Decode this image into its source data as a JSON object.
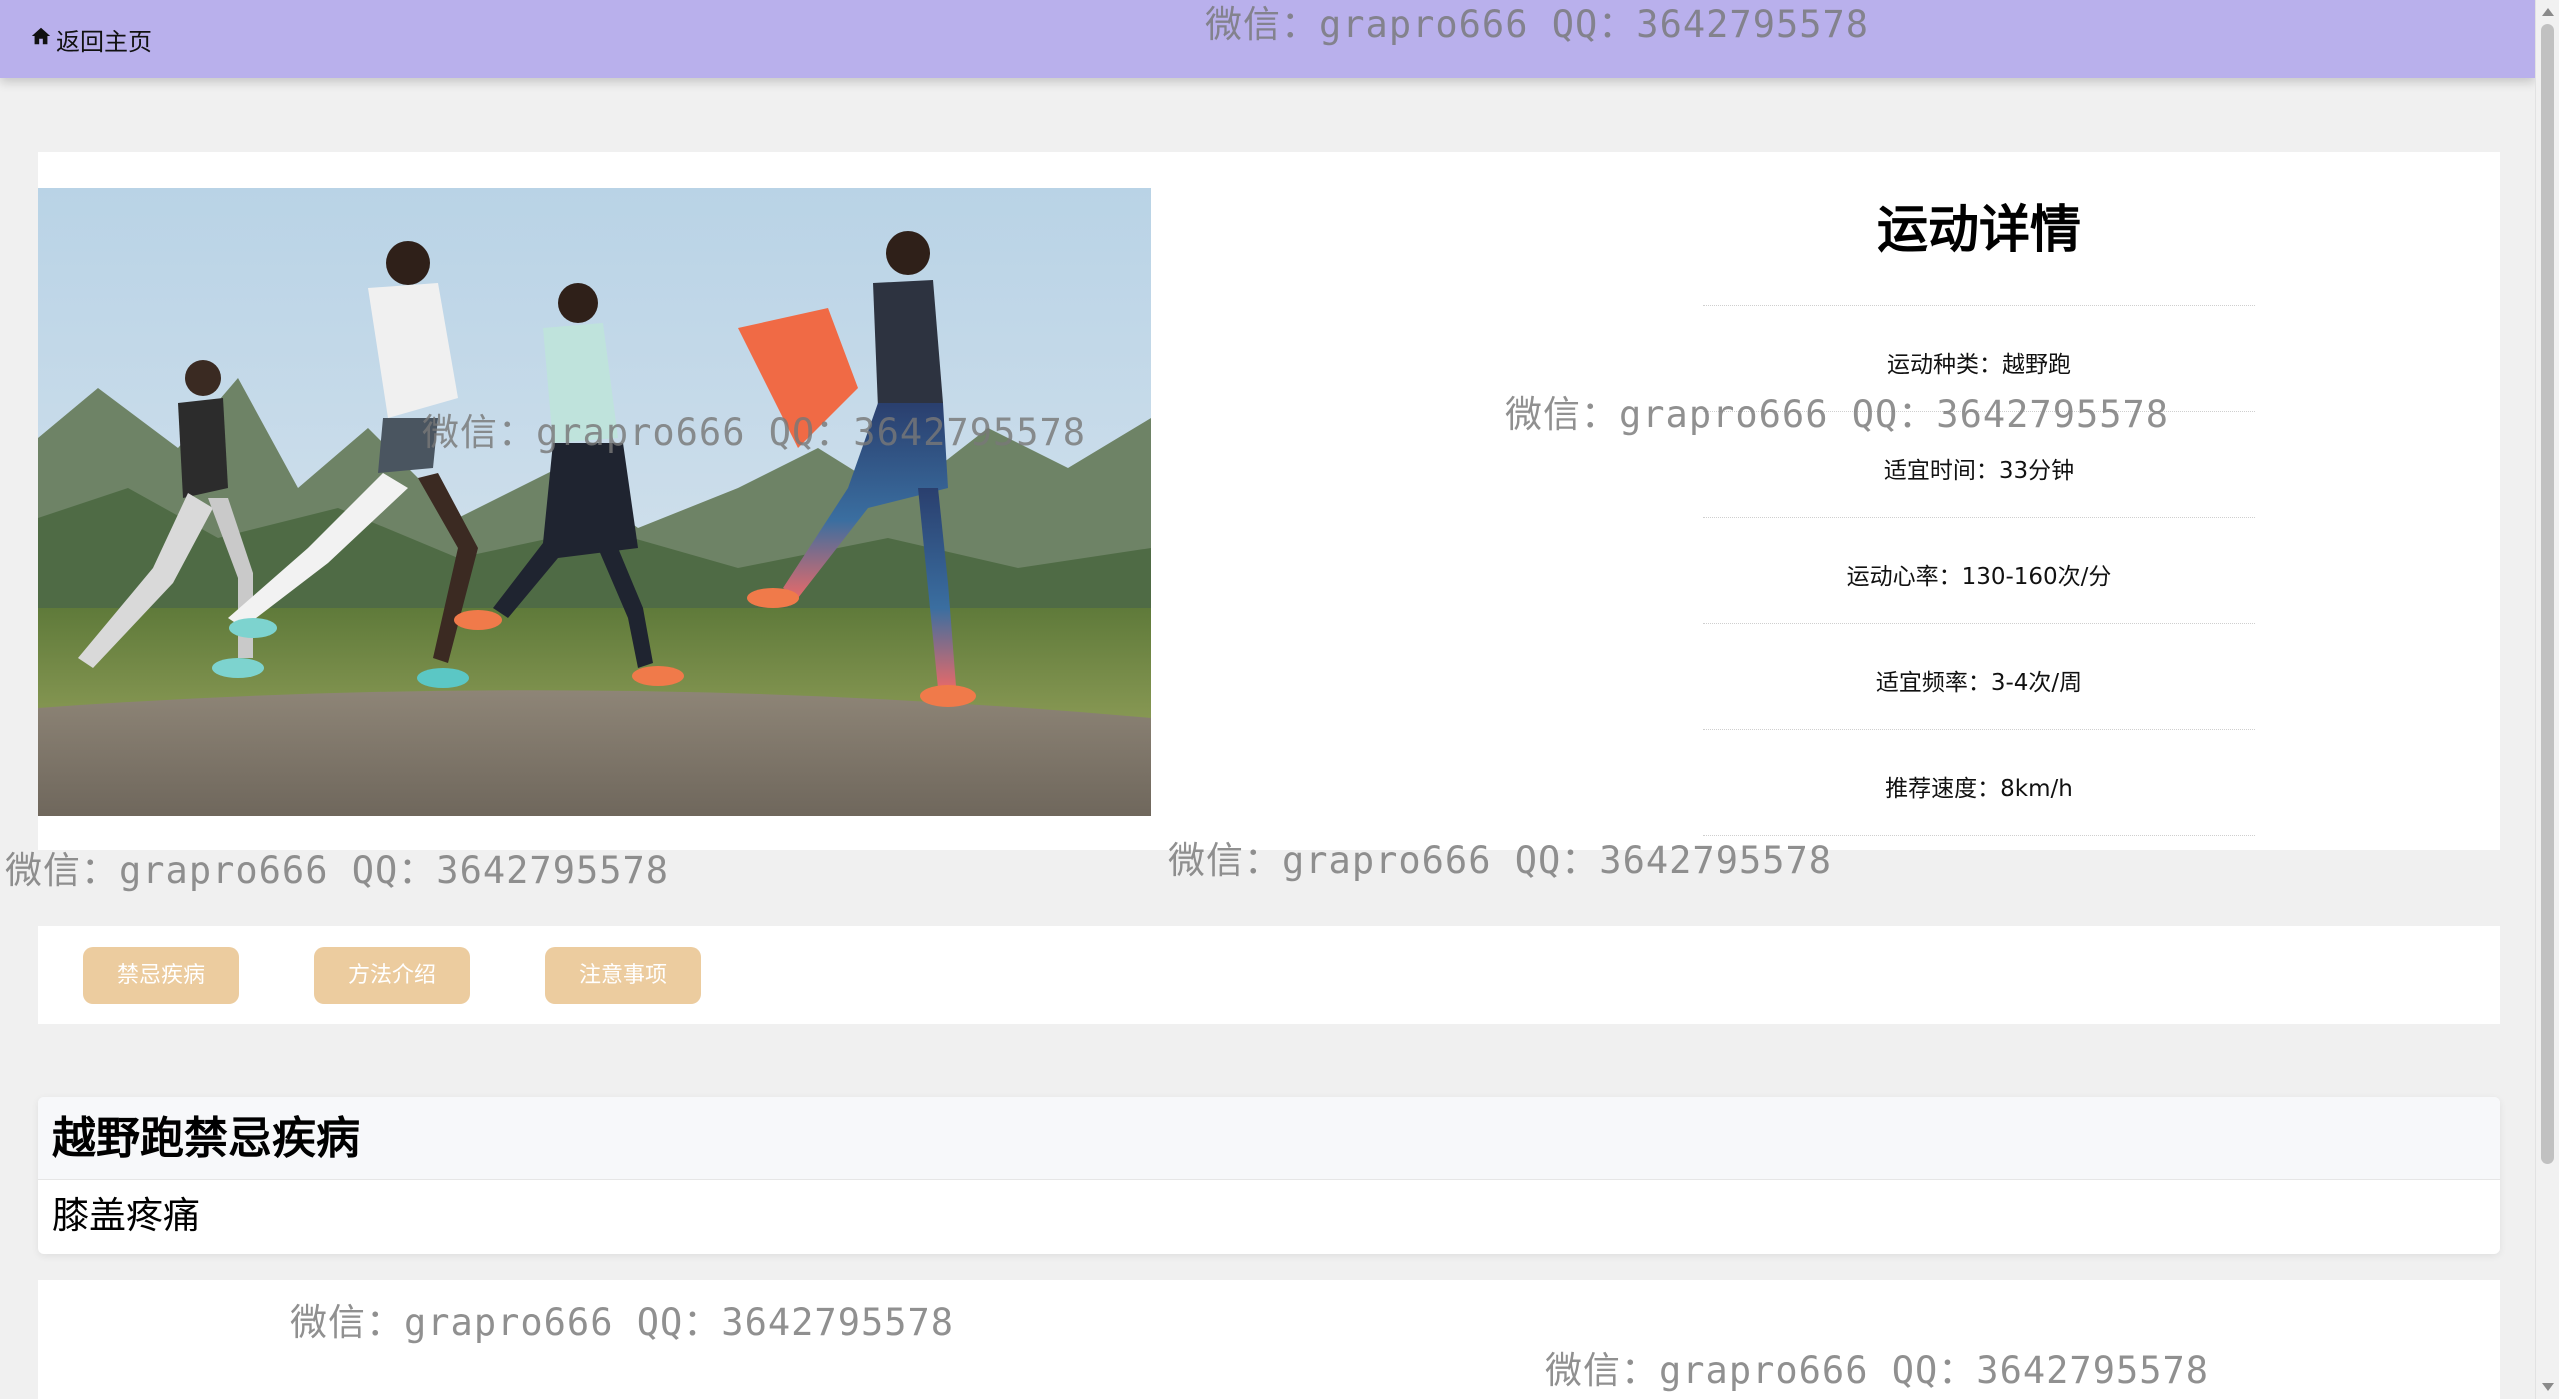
{
  "header": {
    "back_label": "返回主页",
    "back_icon": "home-icon",
    "background": "#b9b0ec"
  },
  "detail": {
    "image_alt": "越野跑",
    "title": "运动详情",
    "rows": [
      "运动种类：越野跑",
      "适宜时间：33分钟",
      "运动心率：130-160次/分",
      "适宜频率：3-4次/周",
      "推荐速度：8km/h"
    ]
  },
  "tabs": [
    {
      "label": "禁忌疾病",
      "active": true
    },
    {
      "label": "方法介绍",
      "active": false
    },
    {
      "label": "注意事项",
      "active": false
    }
  ],
  "tab_color": "#eccc9f",
  "content": {
    "heading": "越野跑禁忌疾病",
    "body": "膝盖疼痛"
  },
  "watermarks": [
    "微信：grapro666 QQ：3642795578",
    "微信：grapro666 QQ：3642795578",
    "微信：grapro666 QQ：3642795578",
    "微信：grapro666 QQ：3642795578",
    "微信：grapro666 QQ：3642795578",
    "微信：grapro666 QQ：3642795578",
    "微信：grapro666 QQ：3642795578"
  ]
}
